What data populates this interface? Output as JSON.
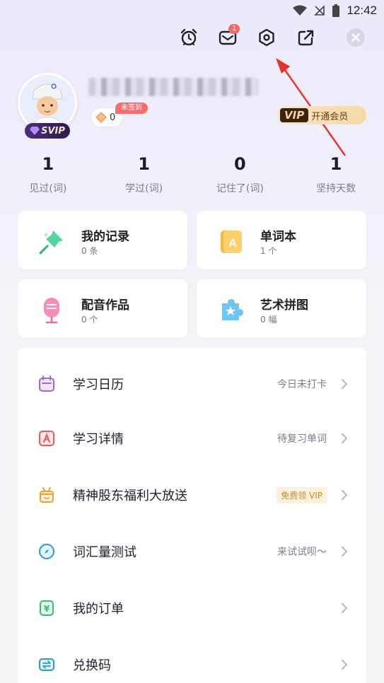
{
  "status_bar": {
    "time": "12:42"
  },
  "header": {
    "message_badge": "1",
    "signin_tag": "未签到",
    "coins": "0",
    "svip_label": "SVIP",
    "vip_logo": "VIP",
    "vip_cta": "开通会员"
  },
  "stats": [
    {
      "value": "1",
      "label": "见过(词)"
    },
    {
      "value": "1",
      "label": "学过(词)"
    },
    {
      "value": "0",
      "label": "记住了(词)"
    },
    {
      "value": "1",
      "label": "坚持天数"
    }
  ],
  "cards": [
    {
      "title": "我的记录",
      "sub": "0 条",
      "icon": "pin-icon"
    },
    {
      "title": "单词本",
      "sub": "1 个",
      "icon": "notebook-icon"
    },
    {
      "title": "配音作品",
      "sub": "0 个",
      "icon": "microphone-icon"
    },
    {
      "title": "艺术拼图",
      "sub": "0 幅",
      "icon": "puzzle-icon"
    }
  ],
  "menu": [
    {
      "label": "学习日历",
      "right": "今日未打卡",
      "icon": "calendar-icon"
    },
    {
      "label": "学习详情",
      "right": "待复习单词",
      "icon": "study-detail-icon"
    },
    {
      "label": "精神股东福利大放送",
      "right": "免费领 VIP",
      "icon": "gift-icon"
    },
    {
      "label": "词汇量测试",
      "right": "来试试呗～",
      "icon": "compass-icon"
    },
    {
      "label": "我的订单",
      "right": "",
      "icon": "order-icon"
    },
    {
      "label": "兑换码",
      "right": "",
      "icon": "redeem-icon"
    }
  ],
  "colors": {
    "accent_red": "#f26a6a",
    "annotation_arrow": "#e8312b",
    "vip_gold": "#f7d8a6"
  }
}
